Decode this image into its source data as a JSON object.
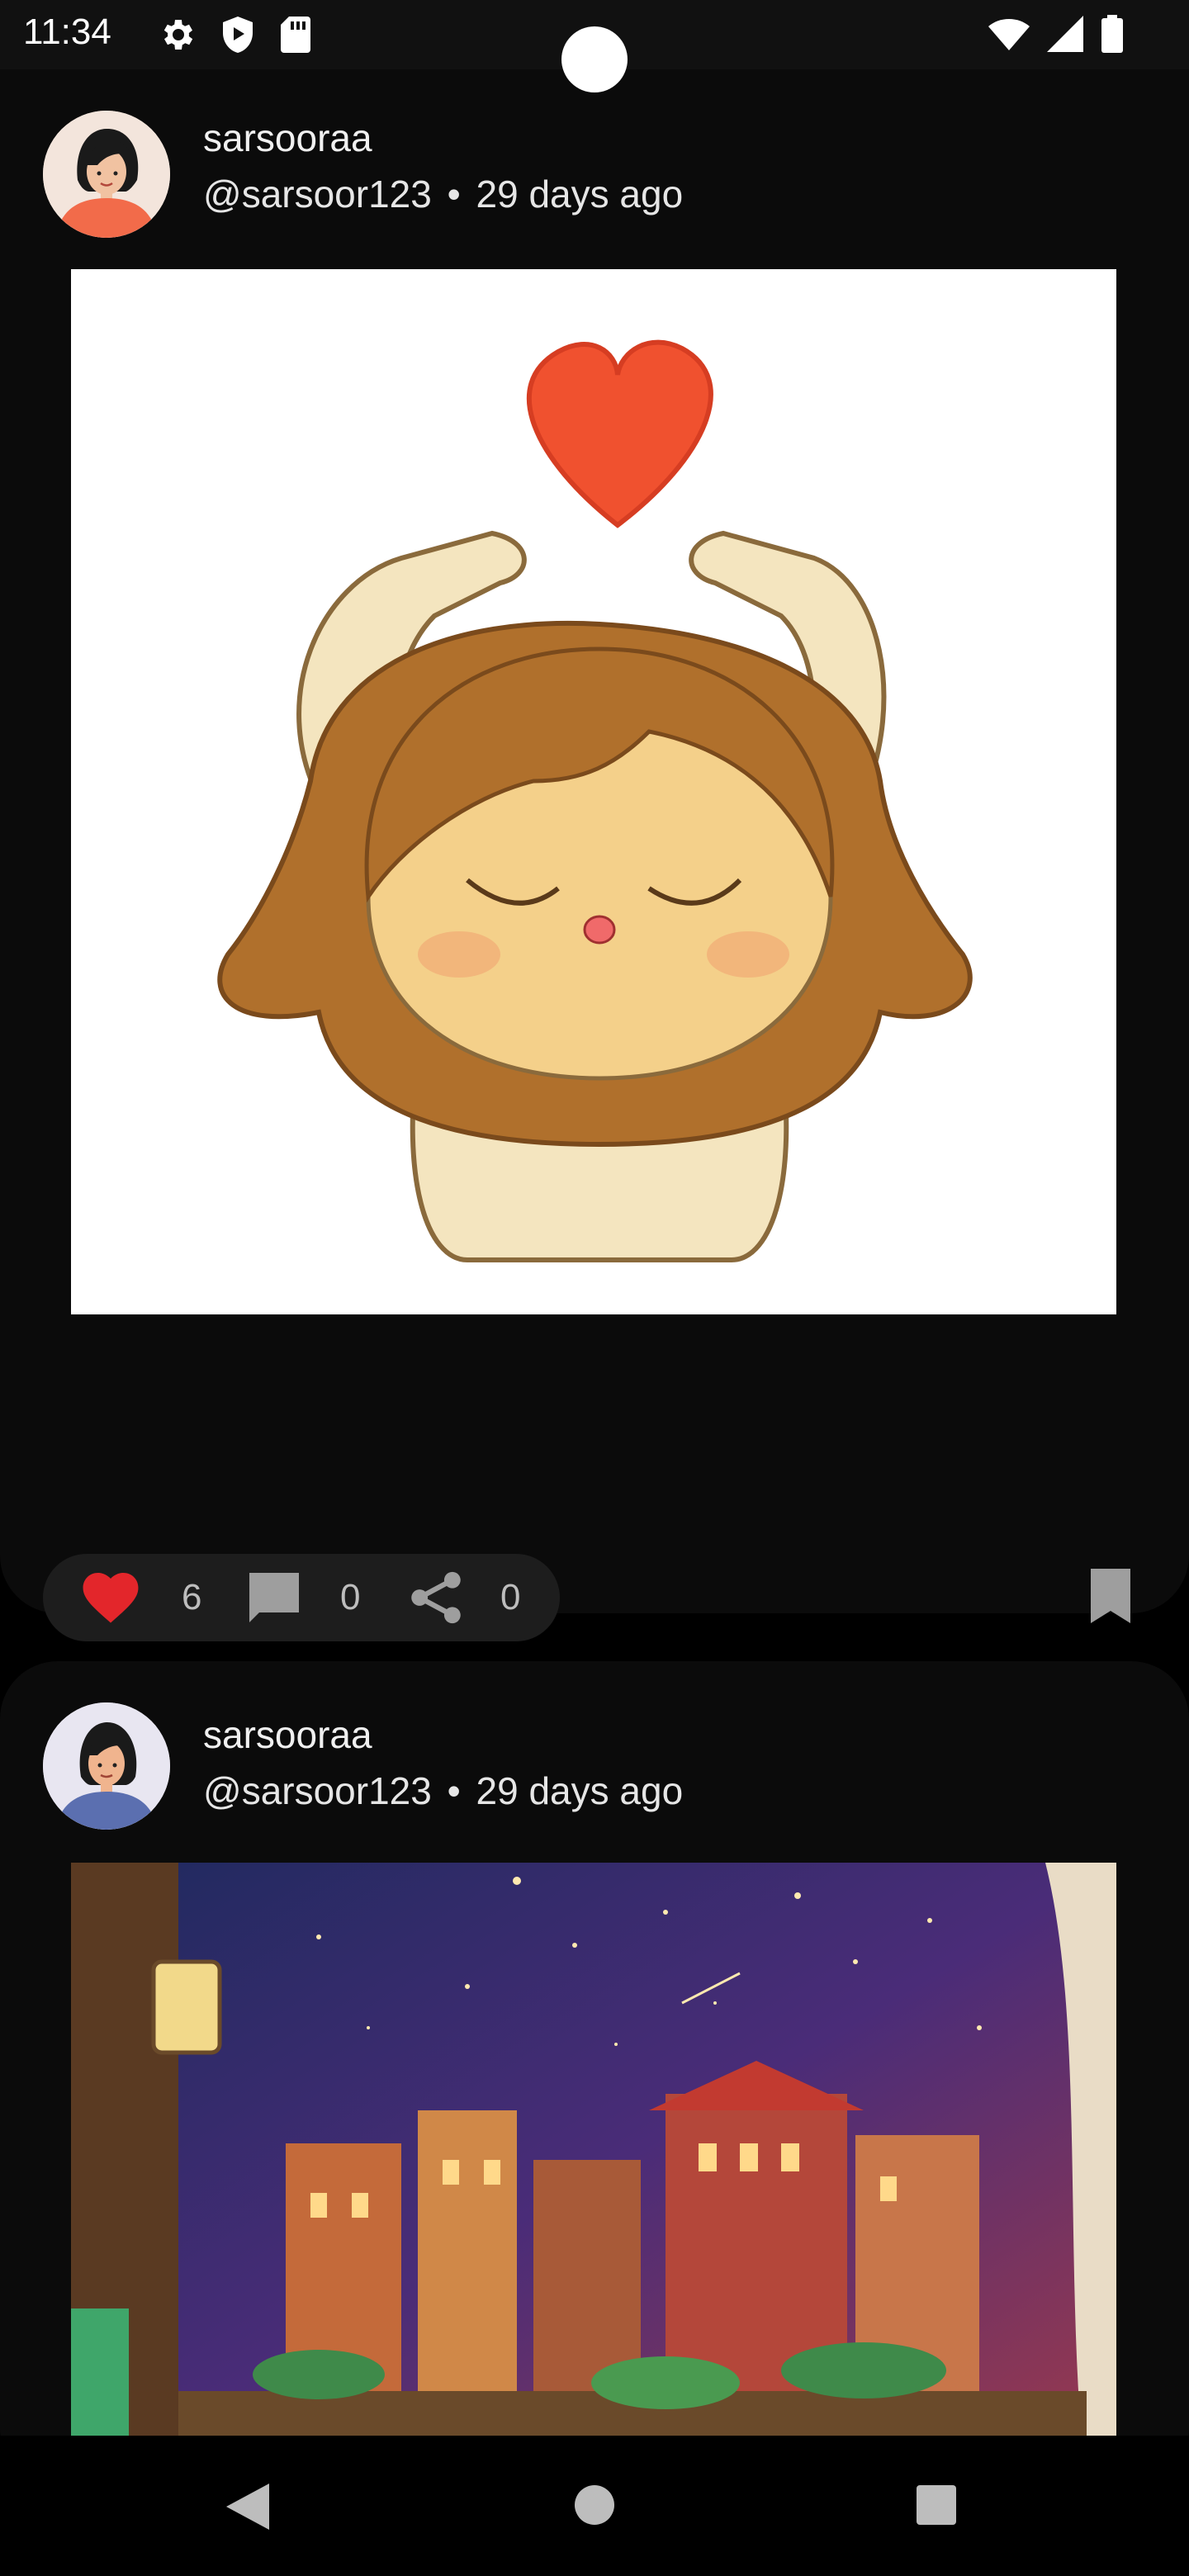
{
  "status_bar": {
    "time": "11:34",
    "icons_left": [
      "gear-icon",
      "play-protect-icon",
      "sd-card-icon"
    ],
    "icons_right": [
      "wifi-icon",
      "signal-icon",
      "battery-icon"
    ]
  },
  "posts": [
    {
      "author": "sarsooraa",
      "handle": "@sarsoor123",
      "separator": "•",
      "time_ago": "29 days ago",
      "likes": "6",
      "comments": "0",
      "shares": "0",
      "liked": true
    },
    {
      "author": "sarsooraa",
      "handle": "@sarsoor123",
      "separator": "•",
      "time_ago": "29 days ago"
    }
  ],
  "colors": {
    "background": "#000000",
    "card": "#0b0b0b",
    "pill": "#1d1d1d",
    "like_red": "#e3262b",
    "icon_gray": "#9e9e9e"
  },
  "nav_bar": {
    "buttons": [
      "back-icon",
      "home-icon",
      "recents-icon"
    ]
  }
}
